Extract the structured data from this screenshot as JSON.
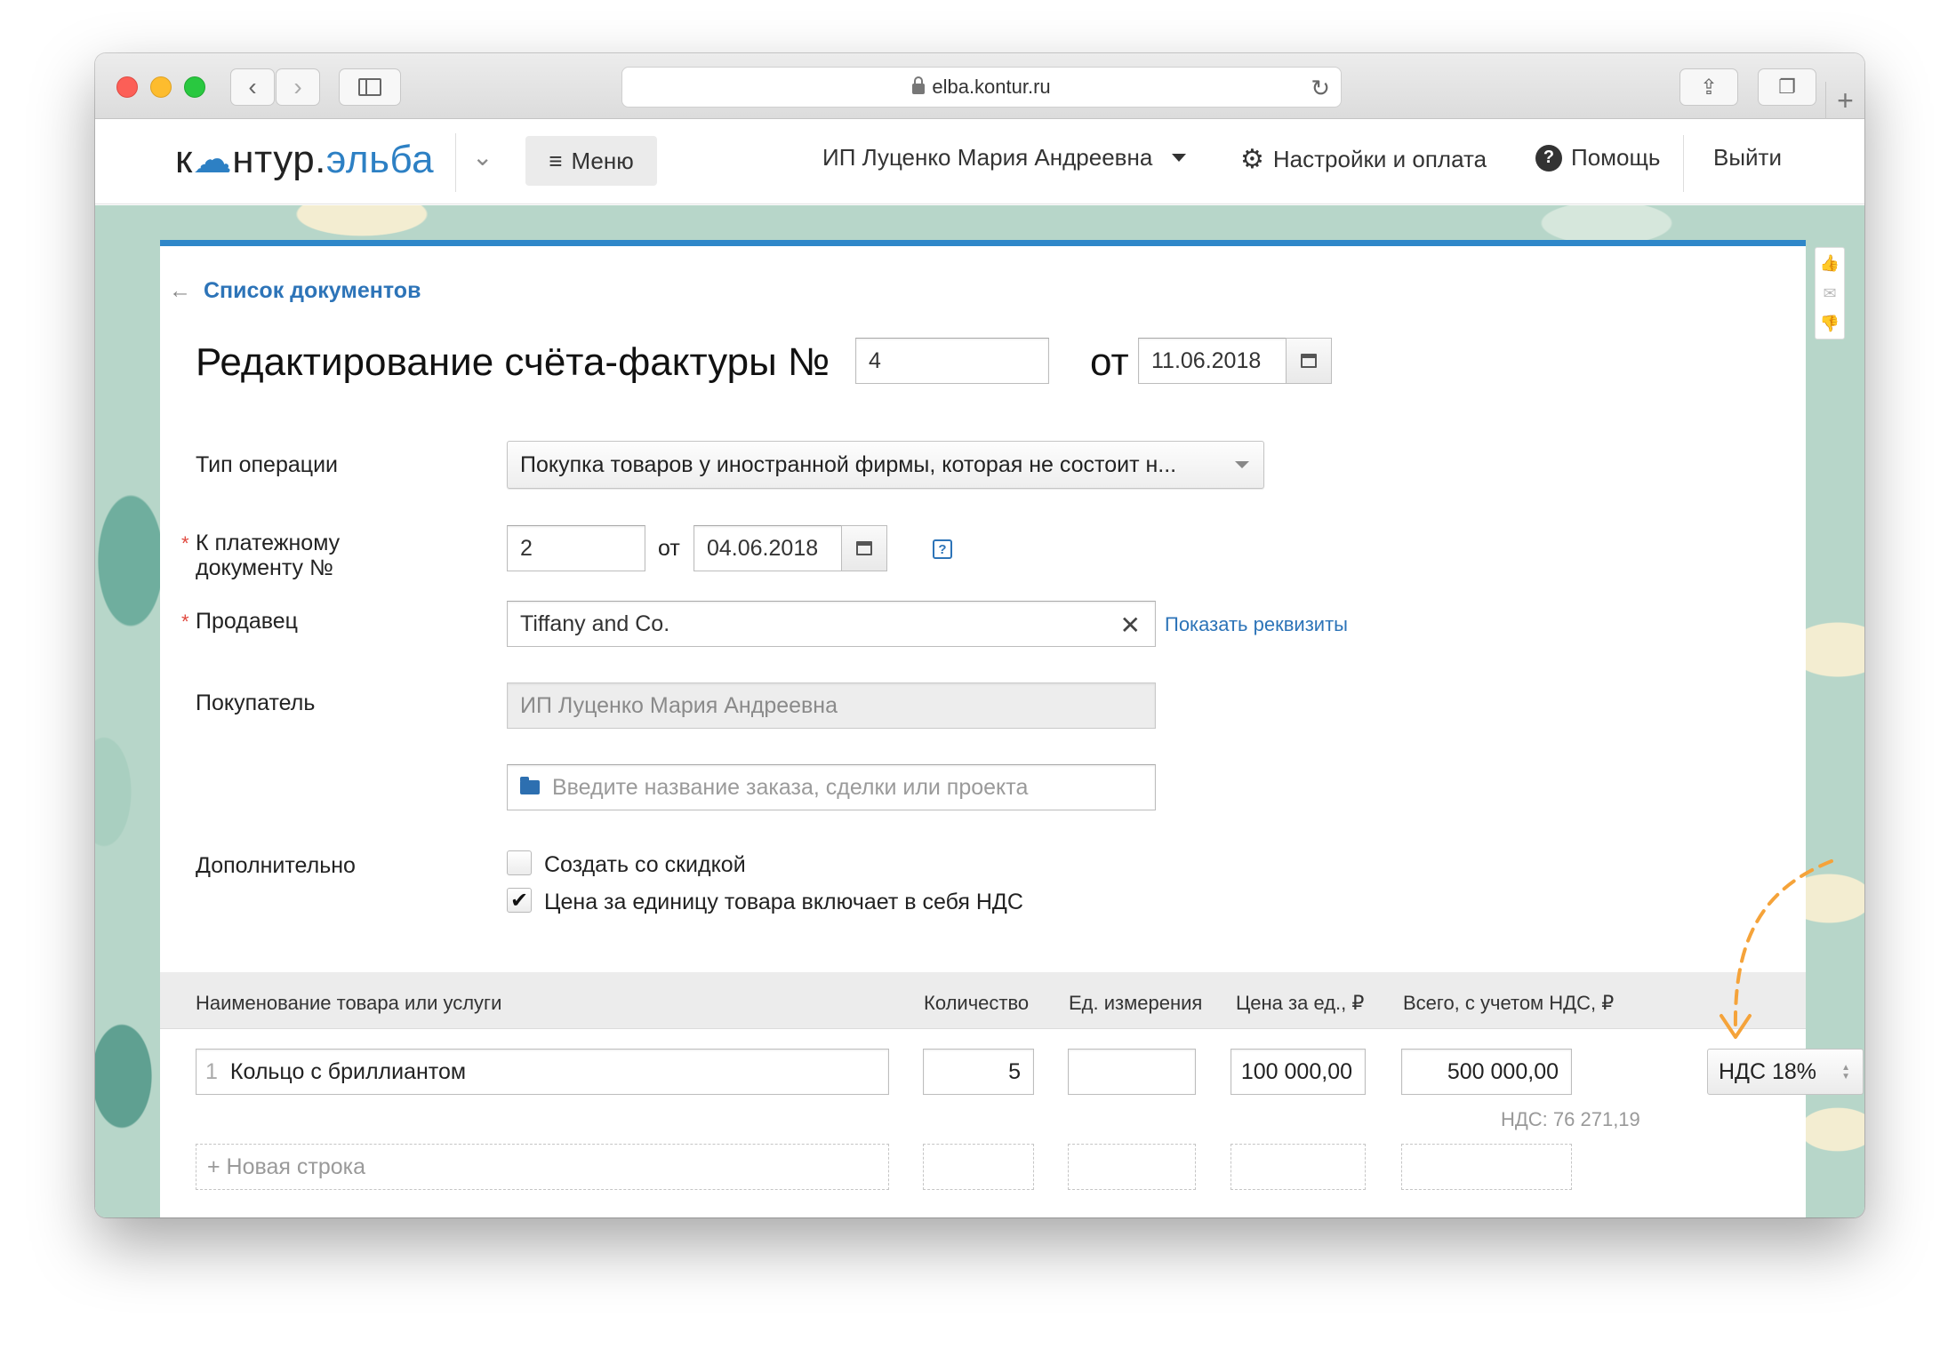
{
  "browser": {
    "url": "elba.kontur.ru"
  },
  "header": {
    "logo_prefix": "к",
    "logo_mid": "нтур.",
    "logo_accent": "эльба",
    "menu_label": "Меню",
    "user_name": "ИП Луценко Мария Андреевна",
    "settings_label": "Настройки и оплата",
    "help_label": "Помощь",
    "logout_label": "Выйти"
  },
  "page": {
    "back_link": "Список документов",
    "title": "Редактирование счёта-фактуры №",
    "number": "4",
    "from_label": "от",
    "date": "11.06.2018"
  },
  "form": {
    "operation_label": "Тип операции",
    "operation_value": "Покупка товаров у иностранной фирмы, которая не состоит н...",
    "payment_label_1": "К платежному",
    "payment_label_2": "документу №",
    "payment_number": "2",
    "payment_from": "от",
    "payment_date": "04.06.2018",
    "help_glyph": "?",
    "seller_label": "Продавец",
    "seller_value": "Tiffany and Co.",
    "show_details": "Показать реквизиты",
    "buyer_label": "Покупатель",
    "buyer_value": "ИП Луценко Мария Андреевна",
    "project_placeholder": "Введите название заказа, сделки или проекта",
    "extra_label": "Дополнительно",
    "discount_label": "Создать со скидкой",
    "discount_checked": false,
    "vat_included_label": "Цена за единицу товара включает в себя НДС",
    "vat_included_checked": true
  },
  "table": {
    "headers": {
      "name": "Наименование товара или услуги",
      "qty": "Количество",
      "unit": "Ед. измерения",
      "price": "Цена за ед., ₽",
      "total": "Всего, с учетом НДС, ₽"
    },
    "rows": [
      {
        "num": "1",
        "name": "Кольцо с бриллиантом",
        "qty": "5",
        "unit": "",
        "price": "100 000,00",
        "total": "500 000,00",
        "vat": "НДС 18%",
        "vat_amount": "НДС:  76 271,19"
      }
    ],
    "new_row": "+ Новая строка"
  },
  "colors": {
    "accent": "#2f87c9",
    "link": "#2d74b8",
    "required": "#e0483e",
    "annotation_arrow": "#f5a33a"
  }
}
